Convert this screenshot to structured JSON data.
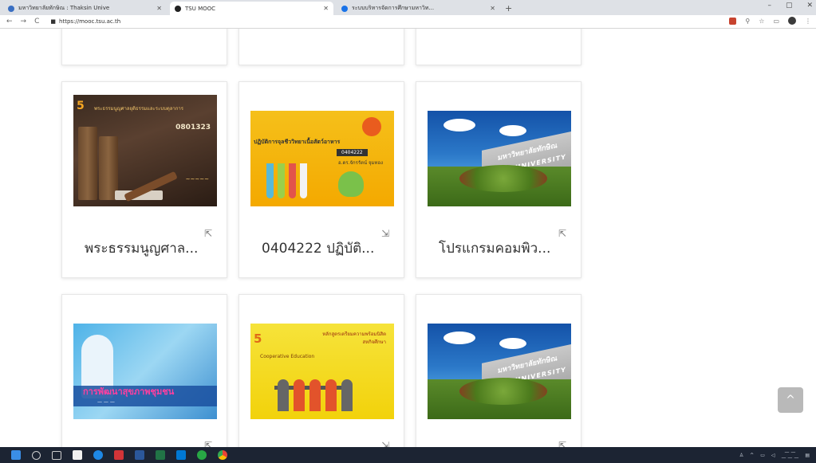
{
  "browser": {
    "tabs": [
      {
        "label": "มหาวิทยาลัยทักษิณ : Thaksin Unive",
        "active": false,
        "favicon_color": "#3a6fc2"
      },
      {
        "label": "TSU MOOC",
        "active": true,
        "favicon_color": "#222222"
      },
      {
        "label": "ระบบบริหารจัดการศึกษามหาวิท...",
        "active": false,
        "favicon_color": "#1a73e8"
      }
    ],
    "url": "https://mooc.tsu.ac.th"
  },
  "cards_row2": [
    {
      "title": "พระธรรมนูญศาล...",
      "thumb": "law"
    },
    {
      "title": "0404222 ปฏิบัติ...",
      "thumb": "lab"
    },
    {
      "title": "โปรแกรมคอมพิว...",
      "thumb": "campus"
    }
  ],
  "thumbs": {
    "law": {
      "header": "พระธรรมนูญศาลยุติธรรมและระบบตุลาการ",
      "code": "0801323",
      "logo": "5"
    },
    "lab": {
      "title": "ปฏิบัติการจุลชีววิทยาเนื้อสัตว์อาหาร",
      "code": "0404222",
      "teacher": "อ.ดร.จักรรัตน์ จุมทอง"
    },
    "campus": {
      "sign": "มหาวิทยาลัยทักษิณ",
      "sign2": "UNIVERSITY"
    },
    "health": {
      "title": "การพัฒนาสุขภาพชุมชน"
    },
    "coop": {
      "logo": "5",
      "line1": "หลักสูตรเตรียมความพร้อมนิสิต",
      "line2": "สหกิจศึกษา",
      "line3": "Cooperative Education"
    }
  },
  "icons": {
    "enrol": "enrol-icon",
    "scroll_top": "chevron-up-icon"
  },
  "scroll_top_glyph": "^"
}
